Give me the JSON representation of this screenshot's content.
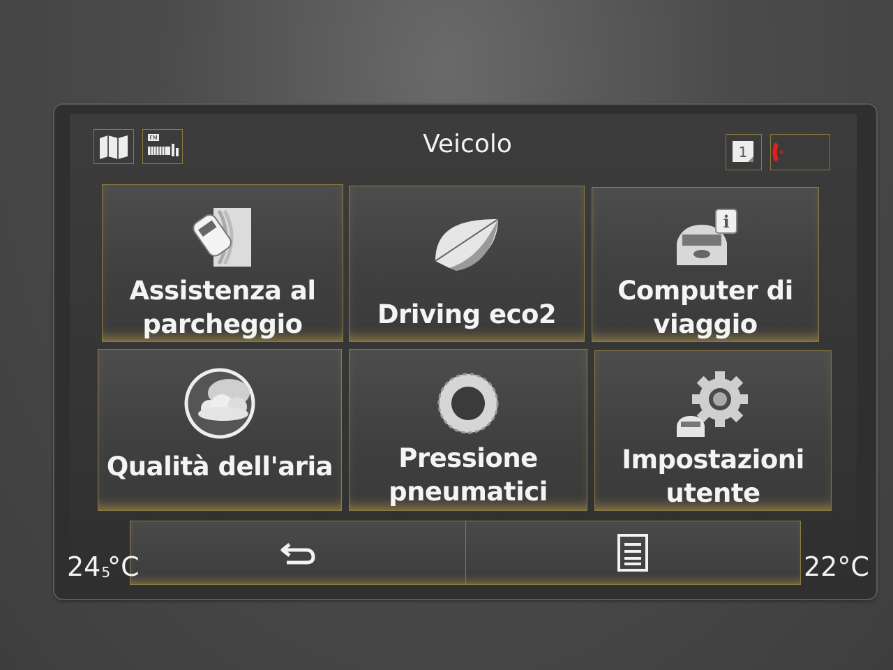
{
  "header": {
    "title": "Veicolo",
    "left_icons": [
      "map-icon",
      "fm-radio-icon"
    ],
    "right_icons": [
      "notification-icon",
      "phone-icon"
    ],
    "notification_count": "1",
    "radio_band": "FM"
  },
  "tiles": [
    {
      "label_line1": "Assistenza al",
      "label_line2": "parcheggio",
      "icon": "parking-assist-icon"
    },
    {
      "label_line1": "Driving eco2",
      "label_line2": "",
      "icon": "eco-leaf-icon"
    },
    {
      "label_line1": "Computer di",
      "label_line2": "viaggio",
      "icon": "trip-computer-icon"
    },
    {
      "label_line1": "Qualità dell'aria",
      "label_line2": "",
      "icon": "air-quality-icon"
    },
    {
      "label_line1": "Pressione",
      "label_line2": "pneumatici",
      "icon": "tire-pressure-icon"
    },
    {
      "label_line1": "Impostazioni",
      "label_line2": "utente",
      "icon": "user-settings-icon"
    }
  ],
  "bottom": {
    "back_icon": "back-arrow-icon",
    "menu_icon": "list-menu-icon"
  },
  "temps": {
    "left": "24",
    "left_decimal": "5",
    "left_unit": "°C",
    "right": "22°C"
  },
  "colors": {
    "accent": "#c9a64a",
    "text": "#f4f4f4",
    "phone_red": "#e02020"
  }
}
